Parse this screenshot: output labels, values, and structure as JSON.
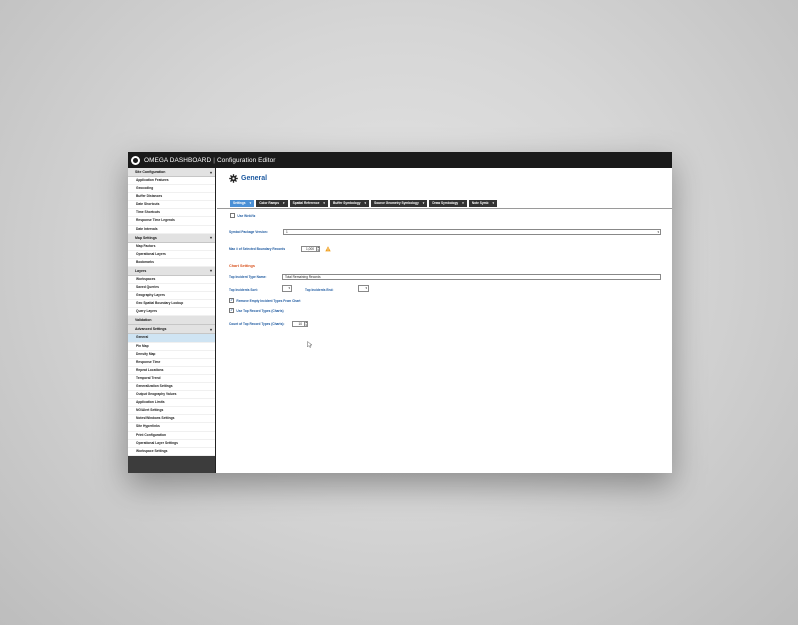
{
  "app": {
    "name": "OMEGA DASHBOARD",
    "separator": "|",
    "subtitle": "Configuration Editor"
  },
  "sidebar": {
    "groups": [
      {
        "label": "Site Configuration",
        "items": [
          "Application Features",
          "Geocoding",
          "Buffer Distances",
          "Date Shortcuts",
          "Time Shortcuts",
          "Response Time Legends",
          "Date Intervals"
        ]
      },
      {
        "label": "Map Settings",
        "items": [
          "Map Factors",
          "Operational Layers",
          "Bookmarks"
        ]
      },
      {
        "label": "Layers",
        "items": [
          "Workspaces",
          "Saved Queries",
          "Geography Layers",
          "Geo Spatial Boundary Lookup",
          "Query Layers"
        ]
      },
      {
        "label": "Validation",
        "items": []
      },
      {
        "label": "Advanced Settings",
        "items": [
          "General",
          "Pin Map",
          "Density Map",
          "Response Time",
          "Repeat Locations",
          "Temporal Trend",
          "Generalization Settings",
          "Output Geography Values",
          "Application Limits",
          "NG/Alert Settings",
          "Notes/Windows Settings",
          "Site Hyperlinks",
          "Print Configuration",
          "Operational Layer Settings",
          "Workspace Settings"
        ]
      }
    ],
    "selected": "General"
  },
  "page": {
    "title": "General",
    "tabs": [
      "Settings",
      "Color Ramps",
      "Spatial Reference",
      "Buffer Symbology",
      "Source Geometry Symbology",
      "Draw Symbology",
      "Note Symb"
    ],
    "active_tab": "Settings"
  },
  "form": {
    "use_webviz": {
      "label": "Use WebViz",
      "checked": false
    },
    "symbol_package_version": {
      "label": "Symbol Package Version:",
      "value": "1"
    },
    "max_boundary_records": {
      "label": "Max # of Selected Boundary Records",
      "value": "1,000"
    },
    "chart_settings": {
      "heading": "Chart Settings",
      "top_incident_type_name": {
        "label": "Top Incident Type Name:",
        "value": "Total Remaining Records"
      },
      "top_incidents_sort": {
        "label": "Top Incidents Sort:",
        "value": ""
      },
      "top_incidents_end": {
        "label": "Top Incidents End:",
        "value": ""
      },
      "remove_empty": {
        "label": "Remove Empty Incident Types From Chart",
        "checked": true
      },
      "use_top_record_types": {
        "label": "Use Top Record Types (Charts)",
        "checked": true
      },
      "count_top_record_types": {
        "label": "Count of Top Record Types (Charts):",
        "value": "10"
      }
    }
  },
  "icons": {
    "gear": "gear-icon",
    "warning": "warning-icon",
    "chevron": "chevron-down-icon"
  },
  "colors": {
    "accent": "#4a90d6",
    "title_blue": "#1e5aa0",
    "section_orange": "#d9531e",
    "titlebar": "#1a1a1a"
  }
}
